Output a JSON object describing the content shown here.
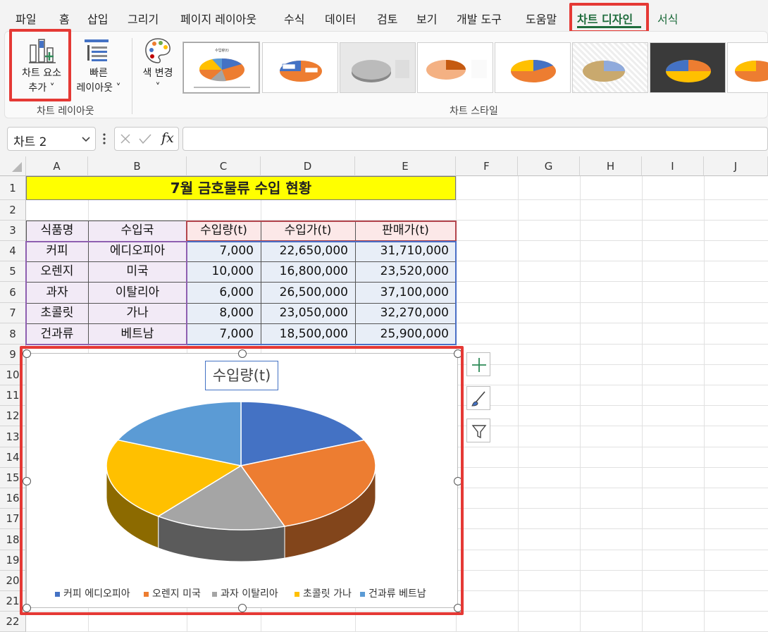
{
  "tabs": [
    {
      "label": "파일"
    },
    {
      "label": "홈"
    },
    {
      "label": "삽입"
    },
    {
      "label": "그리기"
    },
    {
      "label": "페이지 레이아웃"
    },
    {
      "label": "수식"
    },
    {
      "label": "데이터"
    },
    {
      "label": "검토"
    },
    {
      "label": "보기"
    },
    {
      "label": "개발 도구"
    },
    {
      "label": "도움말"
    },
    {
      "label": "차트 디자인"
    },
    {
      "label": "서식"
    }
  ],
  "ribbon": {
    "add_element": {
      "line1": "차트 요소",
      "line2": "추가",
      "chevron": "˅"
    },
    "quick_layout": {
      "line1": "빠른",
      "line2": "레이아웃",
      "chevron": "˅"
    },
    "change_color": {
      "line1": "색 변경",
      "chevron": "˅"
    },
    "group_layout": "차트 레이아웃",
    "group_styles": "차트 스타일",
    "style_thumb_title": "수입량(t)"
  },
  "formula_bar": {
    "name_box": "차트 2",
    "fx": "fx",
    "formula": ""
  },
  "grid": {
    "columns": [
      "A",
      "B",
      "C",
      "D",
      "E",
      "F",
      "G",
      "H",
      "I",
      "J"
    ],
    "rows": [
      "1",
      "2",
      "3",
      "4",
      "5",
      "6",
      "7",
      "8",
      "9",
      "10",
      "11",
      "12",
      "13",
      "14",
      "15",
      "16",
      "17",
      "18",
      "19",
      "20",
      "21",
      "22"
    ]
  },
  "sheet": {
    "title": "7월 금호물류 수입 현황",
    "headers": [
      "식품명",
      "수입국",
      "수입량(t)",
      "수입가(t)",
      "판매가(t)"
    ],
    "rows": [
      [
        "커피",
        "에디오피아",
        "7,000",
        "22,650,000",
        "31,710,000"
      ],
      [
        "오렌지",
        "미국",
        "10,000",
        "16,800,000",
        "23,520,000"
      ],
      [
        "과자",
        "이탈리아",
        "6,000",
        "26,500,000",
        "37,100,000"
      ],
      [
        "초콜릿",
        "가나",
        "8,000",
        "23,050,000",
        "32,270,000"
      ],
      [
        "건과류",
        "베트남",
        "7,000",
        "18,500,000",
        "25,900,000"
      ]
    ]
  },
  "chart_data": {
    "type": "pie",
    "title": "수입량(t)",
    "categories": [
      "커피 에디오피아",
      "오렌지 미국",
      "과자 이탈리아",
      "초콜릿 가나",
      "건과류 베트남"
    ],
    "values": [
      7000,
      10000,
      6000,
      8000,
      7000
    ],
    "colors": [
      "#4472c4",
      "#ed7d31",
      "#a5a5a5",
      "#ffc000",
      "#5b9bd5"
    ],
    "legend_position": "bottom",
    "style": "3d"
  },
  "colors": {
    "accent_green": "#1e6c3c",
    "highlight_red": "#e53935",
    "title_fill": "#ffff00",
    "header_fill": "#fce8e8",
    "label_fill": "#f2eaf6",
    "value_fill": "#e8eef7"
  }
}
